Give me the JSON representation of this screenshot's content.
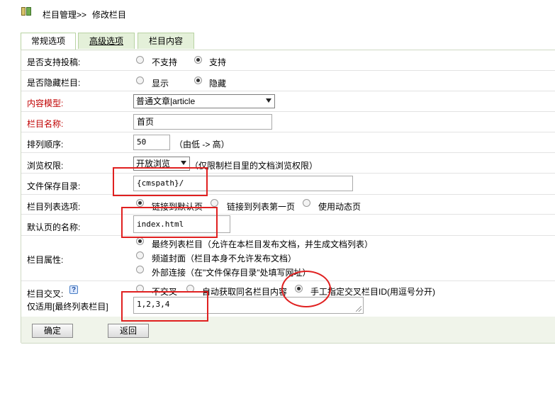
{
  "breadcrumb": {
    "icon": "book-icon",
    "section": "栏目管理>>",
    "current": "修改栏目"
  },
  "tabs": [
    {
      "label": "常规选项"
    },
    {
      "label": "高级选项"
    },
    {
      "label": "栏目内容"
    }
  ],
  "form": {
    "allow_submit": {
      "label": "是否支持投稿:",
      "opt1": "不支持",
      "opt2": "支持",
      "selected": "支持"
    },
    "hidden": {
      "label": "是否隐藏栏目:",
      "opt1": "显示",
      "opt2": "隐藏",
      "selected": "隐藏"
    },
    "content_model": {
      "label": "内容模型:",
      "value": "普通文章|article"
    },
    "name": {
      "label": "栏目名称:",
      "value": "首页"
    },
    "order": {
      "label": "排列顺序:",
      "value": "50",
      "hint": "（由低 -> 高）"
    },
    "browse": {
      "label": "浏览权限:",
      "value": "开放浏览",
      "hint": "（仅限制栏目里的文档浏览权限）"
    },
    "save_dir": {
      "label": "文件保存目录:",
      "value": "{cmspath}/"
    },
    "list_option": {
      "label": "栏目列表选项:",
      "opt1": "链接到默认页",
      "opt2": "链接到列表第一页",
      "opt3": "使用动态页",
      "selected": "链接到默认页"
    },
    "default_page": {
      "label": "默认页的名称:",
      "value": "index.html"
    },
    "attribute": {
      "label": "栏目属性:",
      "opt1": "最终列表栏目（允许在本栏目发布文档，并生成文档列表）",
      "opt2": "频道封面（栏目本身不允许发布文档）",
      "opt3": "外部连接（在\"文件保存目录\"处填写网址）",
      "selected": "最终列表栏目（允许在本栏目发布文档，并生成文档列表）"
    },
    "cross": {
      "label": "栏目交叉:",
      "help": "?",
      "opt1": "不交叉",
      "opt2": "自动获取同名栏目内容",
      "opt3": "手工指定交叉栏目ID(用逗号分开)",
      "selected": "手工指定交叉栏目ID(用逗号分开)",
      "sub_label": "仅适用[最终列表栏目]",
      "ids": "1,2,3,4"
    }
  },
  "buttons": {
    "confirm": "确定",
    "back": "返回"
  },
  "colors": {
    "required_label": "#c00000",
    "annotation": "#e02020",
    "tab_bg": "#e4f0d9"
  }
}
